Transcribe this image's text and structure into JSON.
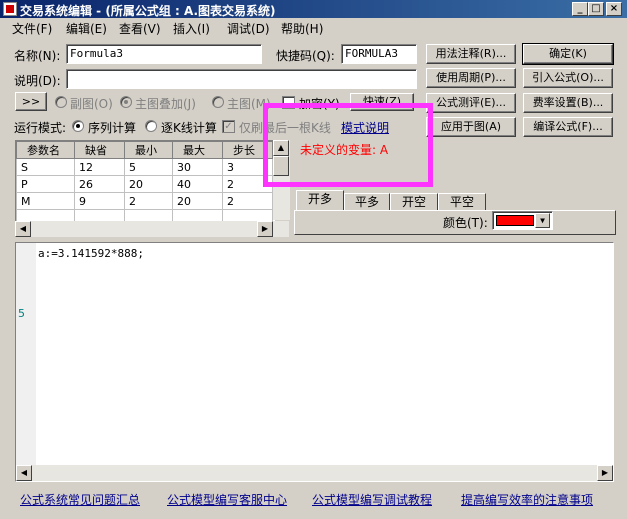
{
  "window": {
    "title": "交易系统编辑 - (所属公式组 : A.图表交易系统)",
    "controls": {
      "minimize": "_",
      "maximize": "□",
      "close": "×"
    }
  },
  "menu": [
    "文件(F)",
    "编辑(E)",
    "查看(V)",
    "插入(I)",
    "调试(D)",
    "帮助(H)"
  ],
  "form": {
    "name_label": "名称(N):",
    "name_value": "Formula3",
    "shortcut_label": "快捷码(Q):",
    "shortcut_value": "FORMULA3",
    "desc_label": "说明(D):",
    "desc_value": "",
    "expand_button": ">>",
    "mode_options": [
      {
        "label": "副图(O)",
        "selected": false,
        "enabled": false
      },
      {
        "label": "主图叠加(J)",
        "selected": true,
        "enabled": false
      },
      {
        "label": "主图(M)",
        "selected": false,
        "enabled": false
      }
    ],
    "encrypt_label": "加密(Y)",
    "fast_label": "快速(Z)",
    "run_mode_label": "运行模式:",
    "run_options": [
      {
        "label": "序列计算",
        "selected": true
      },
      {
        "label": "逐K线计算",
        "selected": false
      }
    ],
    "last_kline_label": "仅刷最后一根K线",
    "mode_help_link": "模式说明"
  },
  "buttons": {
    "usage": "用法注释(R)...",
    "confirm": "确定(K)",
    "period": "使用周期(P)...",
    "import": "引入公式(O)...",
    "test": "公式测评(E)...",
    "rate": "费率设置(B)...",
    "apply": "应用于图(A)",
    "compile": "编译公式(F)..."
  },
  "params": {
    "headers": [
      "参数名",
      "缺省",
      "最小",
      "最大",
      "步长"
    ],
    "rows": [
      [
        "S",
        "12",
        "5",
        "30",
        "3"
      ],
      [
        "P",
        "26",
        "20",
        "40",
        "2"
      ],
      [
        "M",
        "9",
        "2",
        "20",
        "2"
      ]
    ]
  },
  "status": {
    "undefined_var": "未定义的变量: A"
  },
  "tabs": [
    "开多",
    "平多",
    "开空",
    "平空"
  ],
  "color_label": "颜色(T):",
  "color_value": "#ff0000",
  "editor": {
    "code": "a:=3.141592*888;",
    "gutter_number": "5"
  },
  "footer_links": [
    "公式系统常见问题汇总",
    "公式模型编写客服中心",
    "公式模型编写调试教程",
    "提高编写效率的注意事项"
  ],
  "colors": {
    "title_bar": "#0a246a",
    "window_bg": "#d4d0c8",
    "error_text": "#ff0000",
    "link": "#00008b",
    "highlight_box": "#ff33ff"
  }
}
